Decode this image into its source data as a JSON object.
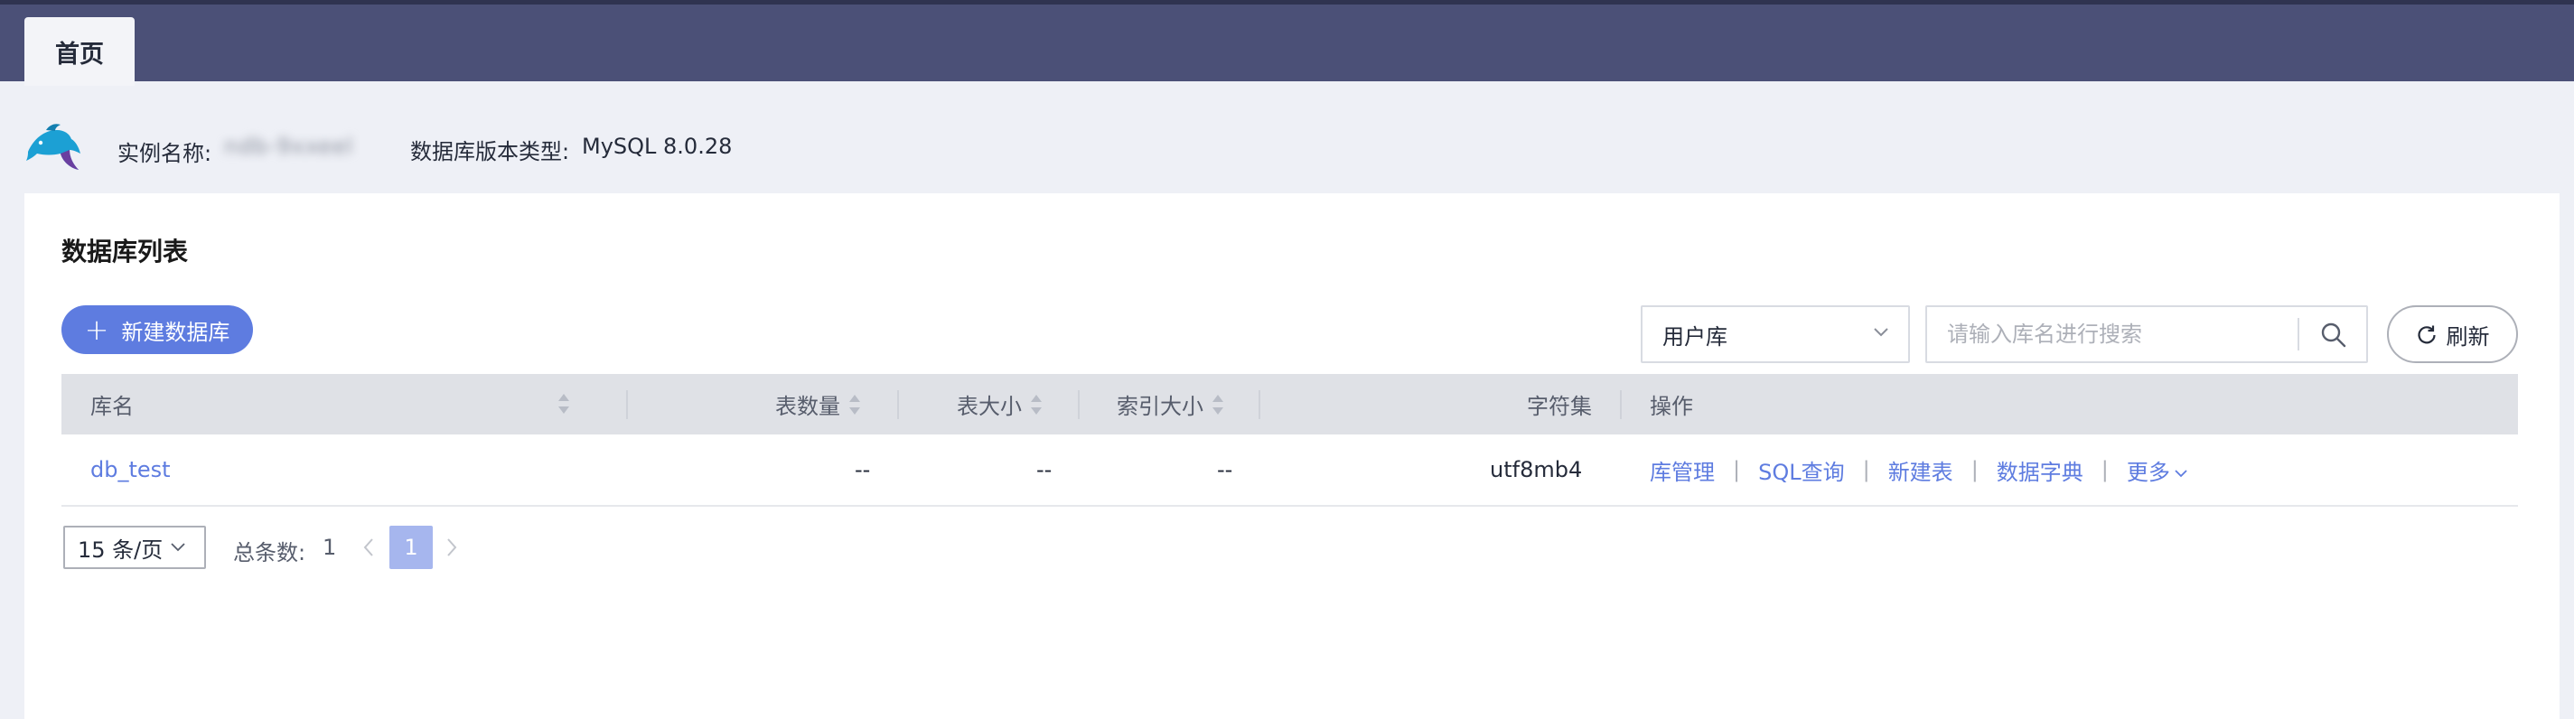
{
  "tabs": [
    {
      "label": "首页"
    }
  ],
  "instance": {
    "name_label": "实例名称:",
    "name_value": "ndb-9xxeel",
    "version_label": "数据库版本类型:",
    "version_value": "MySQL 8.0.28"
  },
  "card": {
    "title": "数据库列表"
  },
  "toolbar": {
    "new_button": "新建数据库",
    "db_type_select": "用户库",
    "search_placeholder": "请输入库名进行搜索",
    "refresh_button": "刷新"
  },
  "table": {
    "headers": {
      "name": "库名",
      "table_count": "表数量",
      "table_size": "表大小",
      "index_size": "索引大小",
      "charset": "字符集",
      "actions": "操作"
    },
    "rows": [
      {
        "name": "db_test",
        "table_count": "--",
        "table_size": "--",
        "index_size": "--",
        "charset": "utf8mb4",
        "actions": [
          "库管理",
          "SQL查询",
          "新建表",
          "数据字典",
          "更多"
        ]
      }
    ]
  },
  "pagination": {
    "page_size": "15 条/页",
    "total_label": "总条数:",
    "total_value": "1",
    "current_page": "1"
  },
  "colors": {
    "topbar": "#4b5077",
    "primary": "#5e7ce0",
    "page_active": "#a6b6ee",
    "table_header": "#dfe1e6"
  },
  "icons": [
    "mysql-dolphin-icon",
    "plus-icon",
    "chevron-down-icon",
    "search-icon",
    "refresh-icon",
    "sort-icon",
    "chevron-left-icon",
    "chevron-right-icon"
  ]
}
